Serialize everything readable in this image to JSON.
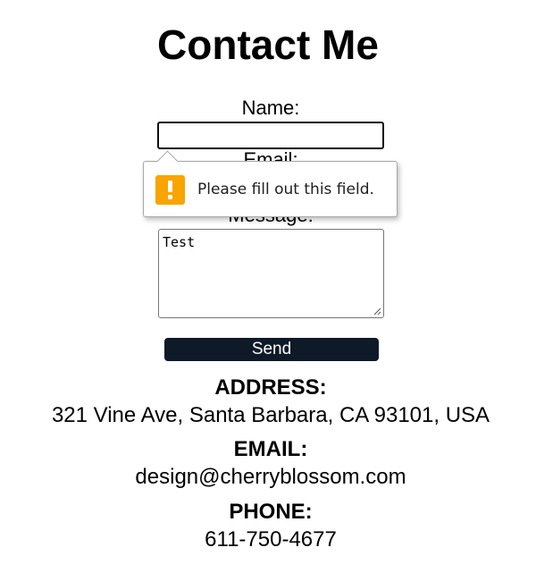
{
  "page": {
    "title": "Contact Me"
  },
  "form": {
    "name_label": "Name:",
    "email_label": "Email:",
    "message_label": "Message:",
    "name_value": "",
    "message_value": "Test",
    "send_label": "Send",
    "send_button_color": "#0f1a29"
  },
  "validation": {
    "message": "Please fill out this field.",
    "icon": "warning-icon",
    "icon_color": "#f9a400"
  },
  "contact": {
    "address_heading": "ADDRESS:",
    "address_value": "321 Vine Ave, Santa Barbara, CA 93101, USA",
    "email_heading": "EMAIL:",
    "email_value": "design@cherryblossom.com",
    "phone_heading": "PHONE:",
    "phone_value": "611-750-4677"
  }
}
